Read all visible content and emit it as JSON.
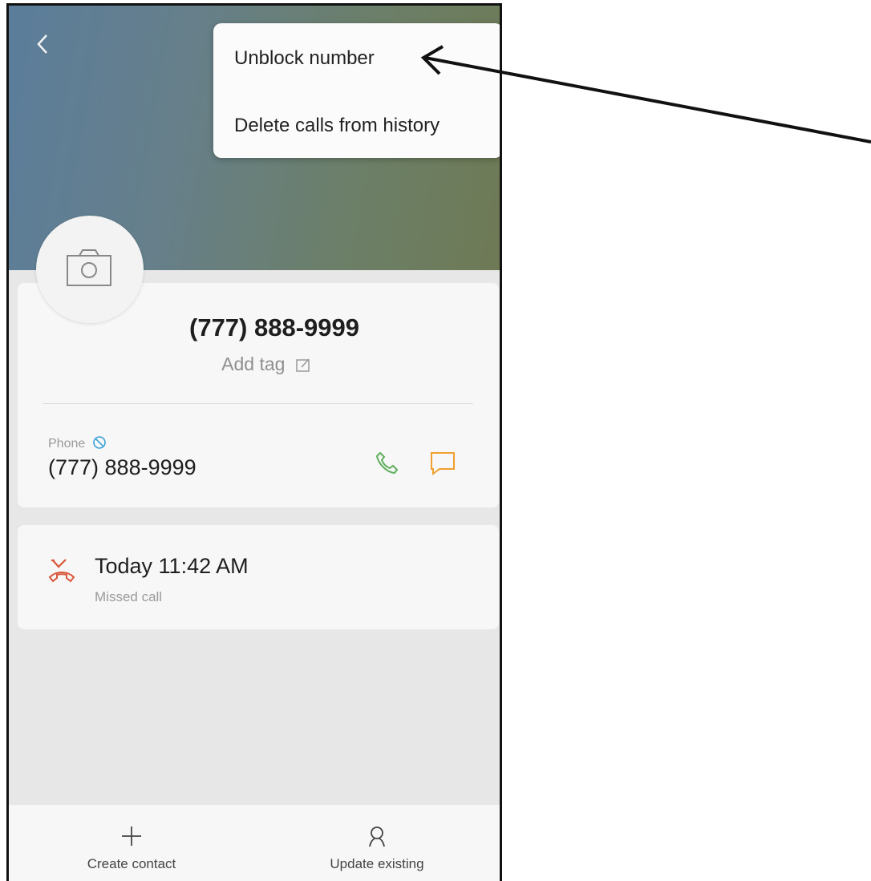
{
  "header": {
    "back_icon": "back-chevron-icon"
  },
  "menu": {
    "items": [
      {
        "label": "Unblock number"
      },
      {
        "label": "Delete calls from history"
      }
    ]
  },
  "contact": {
    "avatar_icon": "camera-icon",
    "title": "(777) 888-9999",
    "add_tag_label": "Add tag",
    "phone": {
      "label": "Phone",
      "number": "(777) 888-9999",
      "blocked_icon": "blocked-icon",
      "call_icon": "phone-icon",
      "message_icon": "message-icon"
    }
  },
  "history": {
    "entries": [
      {
        "time": "Today 11:42 AM",
        "type": "Missed call",
        "icon": "missed-call-icon"
      }
    ]
  },
  "bottom_bar": {
    "create_label": "Create contact",
    "update_label": "Update existing"
  },
  "colors": {
    "call_green": "#5fae5c",
    "message_orange": "#f0a030",
    "missed_red": "#d9583b",
    "blocked_blue": "#3aa3d8"
  }
}
